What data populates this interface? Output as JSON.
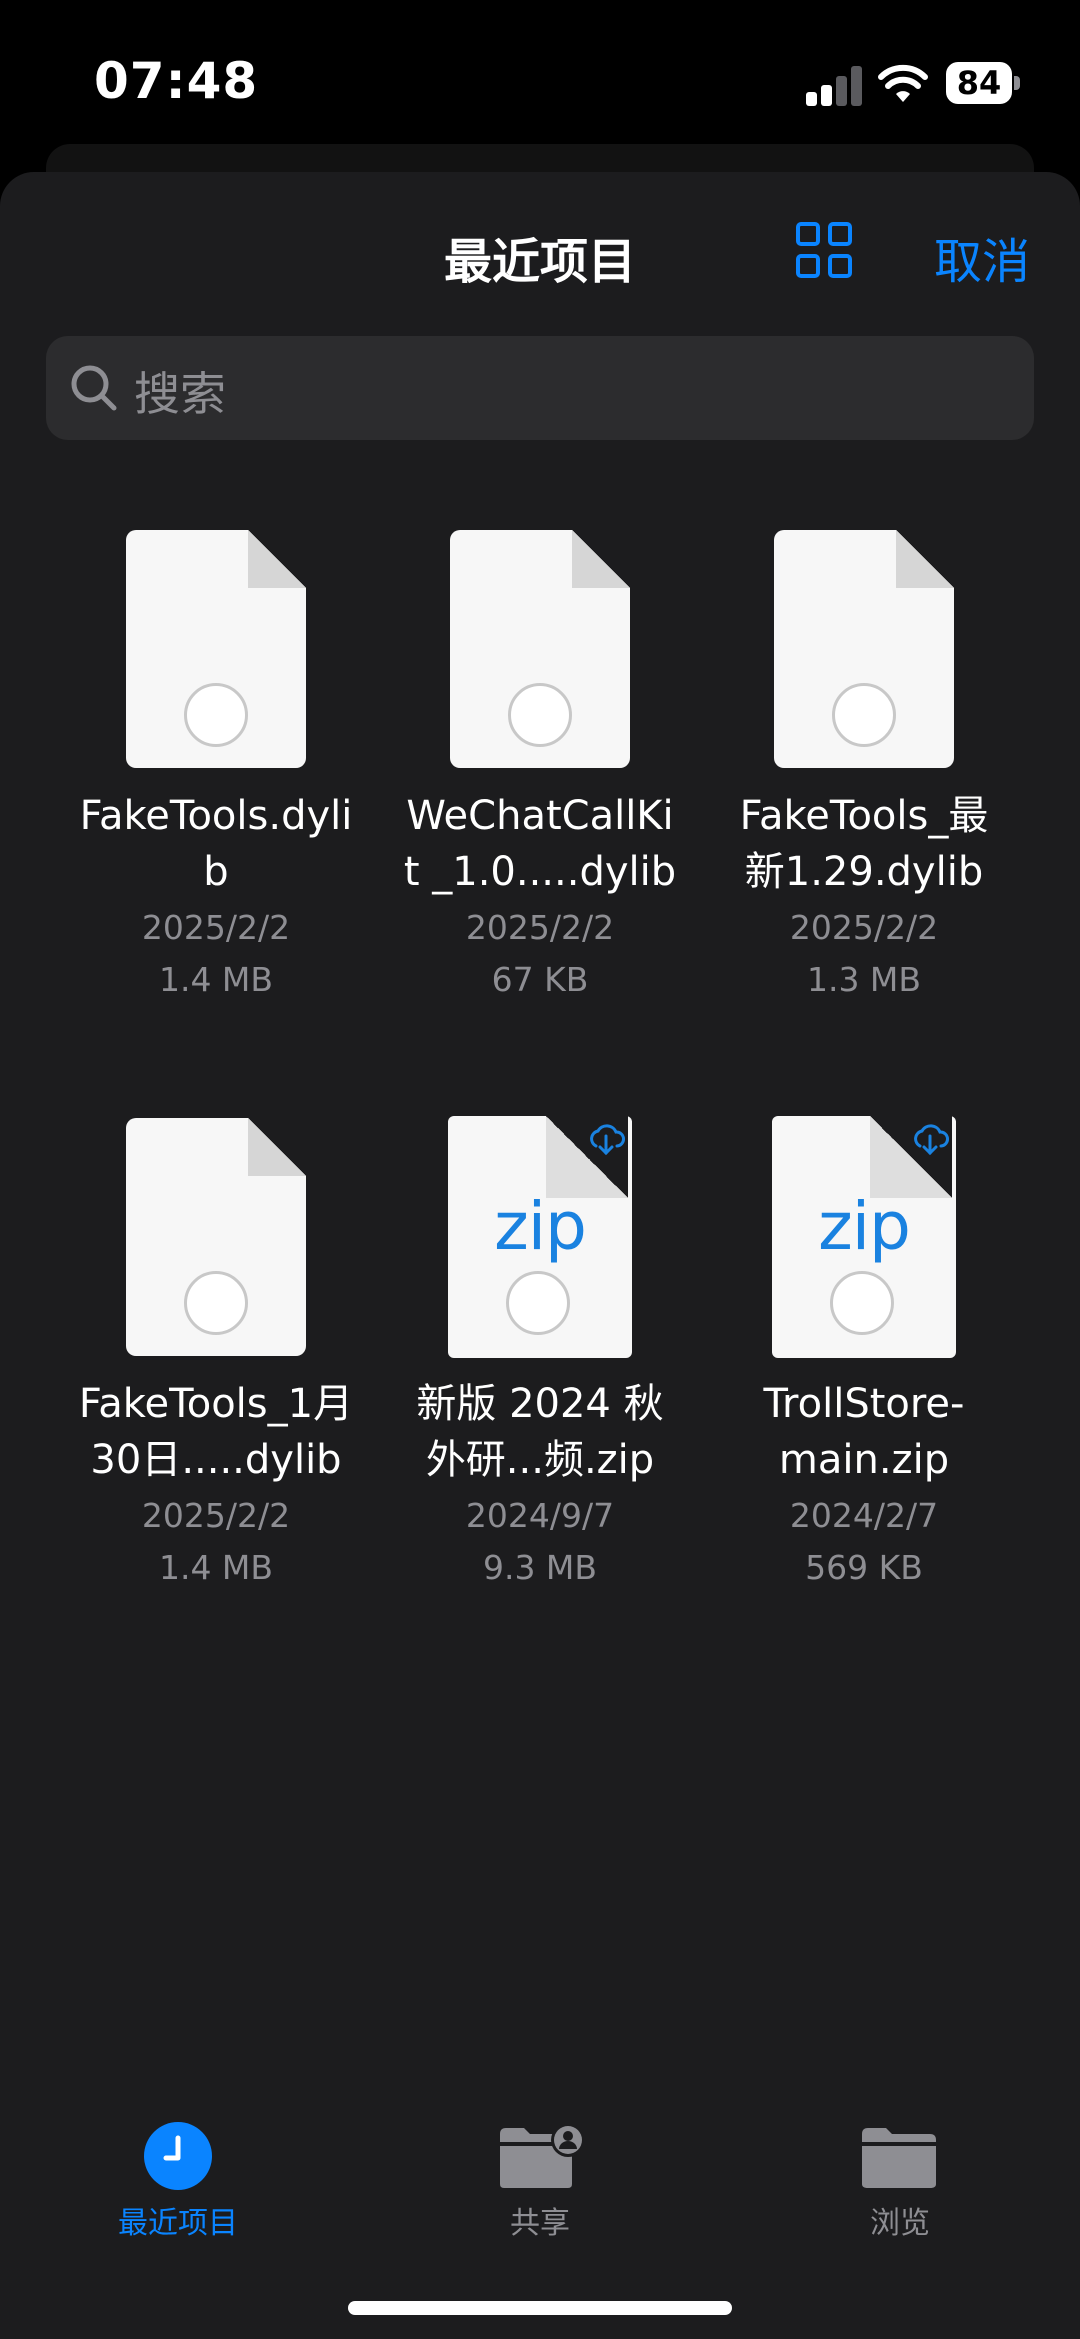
{
  "status_bar": {
    "time": "07:48",
    "battery": "84"
  },
  "header": {
    "title": "最近项目",
    "cancel_label": "取消"
  },
  "search": {
    "placeholder": "搜索"
  },
  "colors": {
    "accent": "#0a84ff",
    "sheet_bg": "#1c1c1e",
    "secondary_text": "#8e8e93",
    "zip_text": "#1a82e0"
  },
  "files": [
    {
      "name_line1": "FakeTools.dyli",
      "name_line2": "b",
      "date": "2025/2/2",
      "size": "1.4 MB",
      "type": "dylib"
    },
    {
      "name_line1": "WeChatCallKi",
      "name_line2": "t _1.0.....dylib",
      "date": "2025/2/2",
      "size": "67 KB",
      "type": "dylib"
    },
    {
      "name_line1": "FakeTools_最",
      "name_line2": "新1.29.dylib",
      "date": "2025/2/2",
      "size": "1.3 MB",
      "type": "dylib"
    },
    {
      "name_line1": "FakeTools_1月",
      "name_line2": "30日.....dylib",
      "date": "2025/2/2",
      "size": "1.4 MB",
      "type": "dylib"
    },
    {
      "name_line1": "新版 2024 秋",
      "name_line2": "外研...频.zip",
      "date": "2024/9/7",
      "size": "9.3 MB",
      "type": "zip",
      "icon_label": "zip"
    },
    {
      "name_line1": "TrollStore-",
      "name_line2": "main.zip",
      "date": "2024/2/7",
      "size": "569 KB",
      "type": "zip",
      "icon_label": "zip"
    }
  ],
  "tabs": [
    {
      "label": "最近项目",
      "icon": "clock-icon",
      "active": true
    },
    {
      "label": "共享",
      "icon": "shared-folder-icon",
      "active": false
    },
    {
      "label": "浏览",
      "icon": "folder-icon",
      "active": false
    }
  ]
}
